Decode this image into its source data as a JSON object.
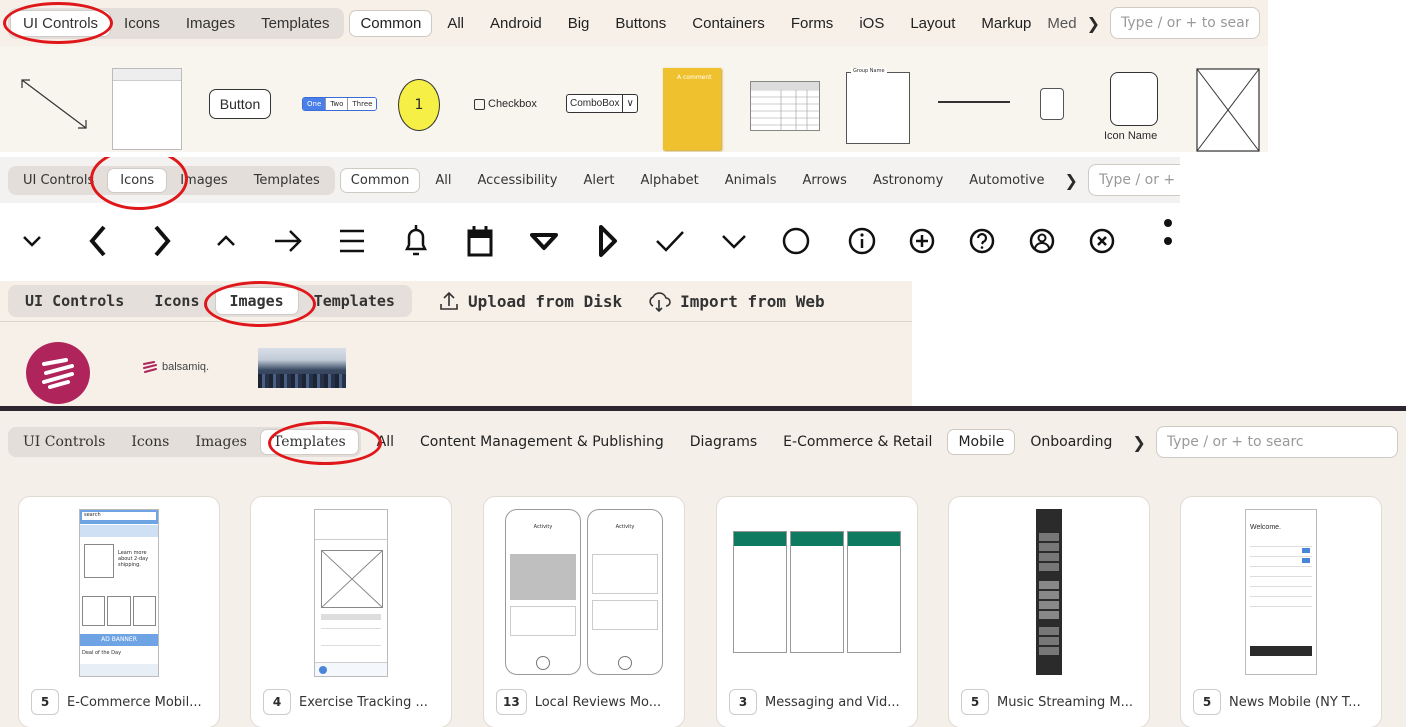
{
  "panel1": {
    "tabs": [
      "UI Controls",
      "Icons",
      "Images",
      "Templates"
    ],
    "categories": [
      "Common",
      "All",
      "Android",
      "Big",
      "Buttons",
      "Containers",
      "Forms",
      "iOS",
      "Layout",
      "Markup"
    ],
    "overflow_label": "Med",
    "search_placeholder": "Type / or + to sear",
    "controls": {
      "button_label": "Button",
      "segmented": [
        "One",
        "Two",
        "Three"
      ],
      "badge_number": "1",
      "checkbox_label": "Checkbox",
      "combobox_label": "ComboBox",
      "comment_text": "A comment",
      "group_label": "Group Name",
      "icon_label": "Icon Name"
    }
  },
  "panel2": {
    "tabs": [
      "UI Controls",
      "Icons",
      "Images",
      "Templates"
    ],
    "categories": [
      "Common",
      "All",
      "Accessibility",
      "Alert",
      "Alphabet",
      "Animals",
      "Arrows",
      "Astronomy",
      "Automotive"
    ],
    "search_placeholder": "Type / or + to s",
    "icons": [
      "chevron-down-icon",
      "chevron-left-bold-icon",
      "chevron-right-bold-icon",
      "chevron-up-icon",
      "arrow-right-icon",
      "menu-icon",
      "bell-icon",
      "calendar-icon",
      "caret-down-icon",
      "caret-right-icon",
      "check-icon",
      "chevron-down-thin-icon",
      "circle-icon",
      "info-circle-icon",
      "plus-circle-icon",
      "question-circle-icon",
      "user-circle-icon",
      "close-circle-icon",
      "more-vertical-icon"
    ]
  },
  "panel3": {
    "tabs": [
      "UI Controls",
      "Icons",
      "Images",
      "Templates"
    ],
    "upload_label": "Upload from Disk",
    "import_label": "Import from Web",
    "logo_text": "balsamiq."
  },
  "panel4": {
    "tabs": [
      "UI Controls",
      "Icons",
      "Images",
      "Templates"
    ],
    "categories": [
      "All",
      "Content Management & Publishing",
      "Diagrams",
      "E-Commerce & Retail",
      "Mobile",
      "Onboarding"
    ],
    "search_placeholder": "Type / or + to searc",
    "templates": [
      {
        "count": "5",
        "title": "E-Commerce Mobil..."
      },
      {
        "count": "4",
        "title": "Exercise Tracking ..."
      },
      {
        "count": "13",
        "title": "Local Reviews Mo..."
      },
      {
        "count": "3",
        "title": "Messaging and Vid..."
      },
      {
        "count": "5",
        "title": "Music Streaming M..."
      },
      {
        "count": "5",
        "title": "News Mobile (NY T..."
      }
    ],
    "thumb_text": {
      "search": "search",
      "learn_more": "Learn more about 2-day shipping.",
      "ad_banner": "AD BANNER",
      "deal": "Deal of the Day",
      "activity": "Activity",
      "welcome": "Welcome."
    }
  },
  "colors": {
    "highlight": "#e0171a",
    "panel_bg": "#f6f0e8",
    "balsamiq": "#b0245c",
    "sticky": "#f0c12e",
    "yellow_badge": "#f6ef45"
  }
}
